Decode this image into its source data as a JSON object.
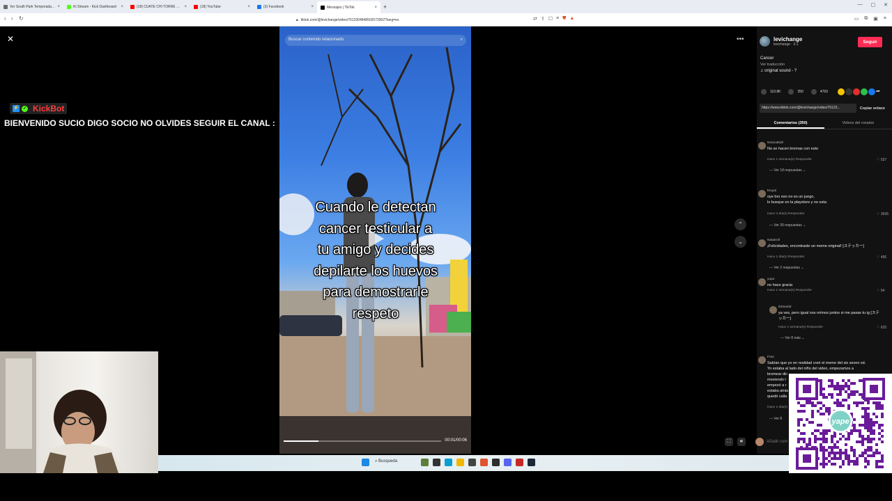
{
  "browser": {
    "tabs": [
      {
        "label": "Ver South Park Temporada 19 Episo",
        "color": "#6a6a6a"
      },
      {
        "label": "Kt Stream - Kick Dashboard",
        "color": "#53fc18"
      },
      {
        "label": "(18) CUATE CHI TORRE DEPORTE MO",
        "color": "#ff0000"
      },
      {
        "label": "(18) YouTube",
        "color": "#ff0000"
      },
      {
        "label": "(3) Facebook",
        "color": "#1877f2"
      },
      {
        "label": "Mensajes | TikTok",
        "color": "#000000"
      }
    ],
    "active_tab": 5,
    "url": "tiktok.com/@levichange/video/7612304848502072902?lang=es"
  },
  "stream": {
    "kickbot_name": "KickBot",
    "welcome_message": "BIENVENIDO SUCIO DIGO SOCIO NO OLVIDES SEGUIR EL CANAL :"
  },
  "video": {
    "search_placeholder": "Buscar contenido relacionado",
    "caption_lines": [
      "Cuando le detectan",
      "cancer testicular a",
      "tu amigo y decides",
      "depilarte los huevos",
      "para demostrarle",
      "respeto"
    ],
    "time": "00:01/00:06",
    "progress_fraction": 0.22
  },
  "panel": {
    "author_name": "levichange",
    "author_sub": "levichange · 3-1",
    "follow_label": "Seguir",
    "description": "Cancer",
    "see_translation": "Ver traducción",
    "sound": "original sound - ?",
    "likes": "110.8K",
    "comments_count": "350",
    "saves": "4763",
    "link": "https://www.tiktok.com/@levichange/video/76123...",
    "copy_label": "Copiar enlace",
    "tab_comments": "Comentarios (350)",
    "tab_creator": "Videos del creador",
    "add_comment": "Añadir com"
  },
  "comments": [
    {
      "name": "Nosoutball",
      "text": "No se hacen bromas con esto",
      "meta": "Hace 1 semana(s)    Responder",
      "likes": "537",
      "more": "Ver 18 respuestas ⌄"
    },
    {
      "name": "bruyai",
      "text": "oye bro eso no es un juego,\nlo busque en la playstore y no esta",
      "meta": "Hace 4 día(s)    Responder",
      "likes": "3536",
      "more": "Ver 30 respuestas ⌄"
    },
    {
      "name": "Natatroll",
      "text": "¡Felicidades, encontraste un meme original! [ステッカー]",
      "meta": "Hace 1 día(s)    Responder",
      "likes": "456",
      "more": "Ver 2 respuestas ⌄"
    },
    {
      "name": "yupo",
      "text": "no hace gracia",
      "meta": "Hace 1 semana(s)    Responder",
      "likes": "54",
      "more": ""
    },
    {
      "name": "DDavidd",
      "text": "ya ves, pero igual nos reímos juntos si me pasas tu ig [ステッカー]",
      "meta": "Hace 1 semana(s)    Responder",
      "likes": "625",
      "more": "Ver 8 más ⌄"
    },
    {
      "name": "Fran",
      "text": "Sabían que yo en realidad creé el meme del six seven xd.\nYo estaba al lado del niño del video, empezamos a\nbromear dic\nmoviendo l\nempezó a r\nestaba atrás\nquedé calla",
      "meta": "Hace 1 día(s)",
      "likes": "",
      "more": "Ver 8"
    }
  ],
  "taskbar": {
    "search_label": "Busqueda"
  },
  "qr": {
    "brand": "yape"
  }
}
